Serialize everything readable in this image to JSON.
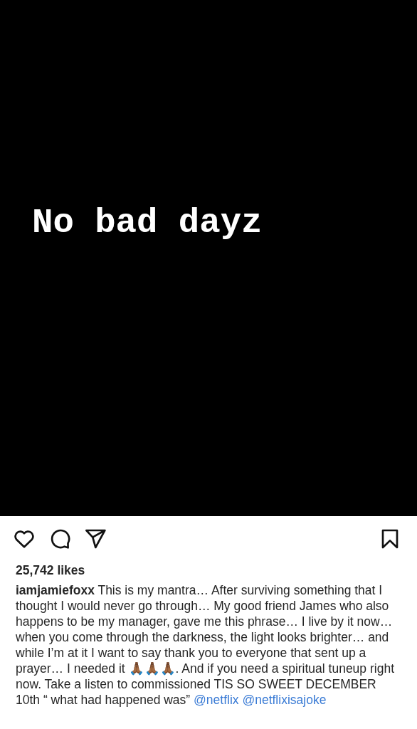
{
  "post": {
    "image_text": "No bad dayz"
  },
  "actions": [
    {
      "kind": "like"
    },
    {
      "kind": "comment"
    },
    {
      "kind": "share"
    },
    {
      "kind": "save"
    }
  ],
  "likes": "25,742 likes",
  "caption": {
    "username": "iamjamiefoxx",
    "text": "This is my mantra… After surviving something that I thought I would never go through… My good friend James who also happens to be my manager, gave me this phrase… I live by it now… when you come through the darkness, the light looks brighter…  and while I’m at it I want to say thank you to everyone that sent up a prayer… I needed it 🙏🏾🙏🏾🙏🏾. And if you need a spiritual tuneup right now. Take a listen to commissioned TIS SO SWEET  DECEMBER 10th “ what had happened was”",
    "mentions": [
      "@netflix",
      "@netflixisajoke"
    ]
  }
}
